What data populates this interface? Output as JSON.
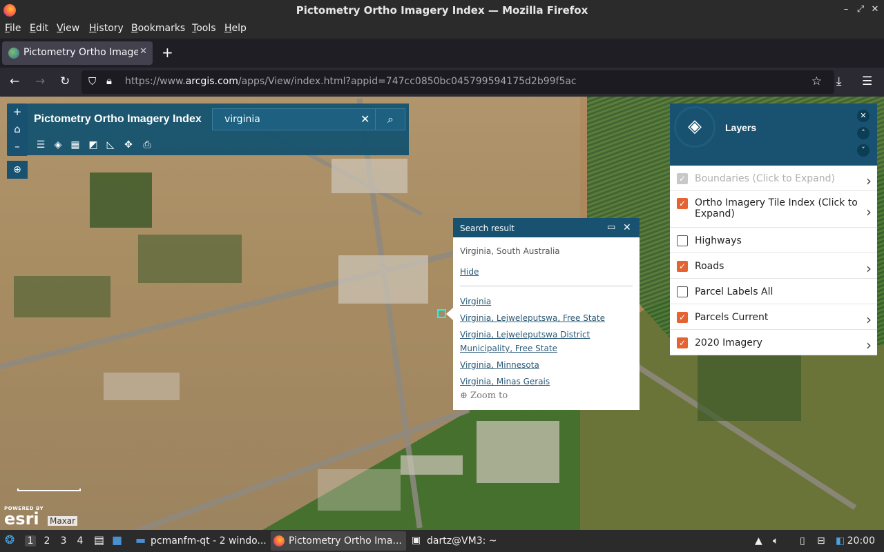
{
  "window": {
    "title": "Pictometry Ortho Imagery Index — Mozilla Firefox"
  },
  "menu": [
    "File",
    "Edit",
    "View",
    "History",
    "Bookmarks",
    "Tools",
    "Help"
  ],
  "tab": {
    "label": "Pictometry Ortho Imager"
  },
  "address": {
    "prefix": "https://www.",
    "domain": "arcgis.com",
    "path": "/apps/View/index.html?appid=747cc0850bc045799594175d2b99f5ac"
  },
  "app": {
    "title": "Pictometry Ortho Imagery Index",
    "search_value": "virginia"
  },
  "popup": {
    "title": "Search result",
    "location": "Virginia, South Australia",
    "hide": "Hide",
    "results": [
      "Virginia",
      "Virginia, Lejweleputswa, Free State",
      "Virginia, Lejweleputswa District Municipality, Free State",
      "Virginia, Minnesota",
      "Virginia, Minas Gerais"
    ],
    "zoom": "Zoom to"
  },
  "layers": {
    "title": "Layers",
    "items": [
      {
        "label": "Boundaries (Click to Expand)",
        "checked": true,
        "disabled": true,
        "chevron": true
      },
      {
        "label": "Ortho Imagery Tile Index (Click to Expand)",
        "checked": true,
        "disabled": false,
        "chevron": true
      },
      {
        "label": "Highways",
        "checked": false,
        "disabled": false,
        "chevron": false
      },
      {
        "label": "Roads",
        "checked": true,
        "disabled": false,
        "chevron": true
      },
      {
        "label": "Parcel Labels All",
        "checked": false,
        "disabled": false,
        "chevron": false
      },
      {
        "label": "Parcels Current",
        "checked": true,
        "disabled": false,
        "chevron": true
      },
      {
        "label": "2020 Imagery",
        "checked": true,
        "disabled": false,
        "chevron": true
      }
    ]
  },
  "attribution": {
    "powered_by": "POWERED BY",
    "esri": "esri",
    "maxar": "Maxar"
  },
  "taskbar": {
    "workspaces": [
      "1",
      "2",
      "3",
      "4"
    ],
    "items": [
      "pcmanfm-qt - 2 windo...",
      "Pictometry Ortho Ima...",
      "dartz@VM3: ~"
    ],
    "clock": "20:00"
  },
  "colors": {
    "header": "#195270",
    "checkbox_on": "#e46332",
    "link": "#2a5a78"
  }
}
